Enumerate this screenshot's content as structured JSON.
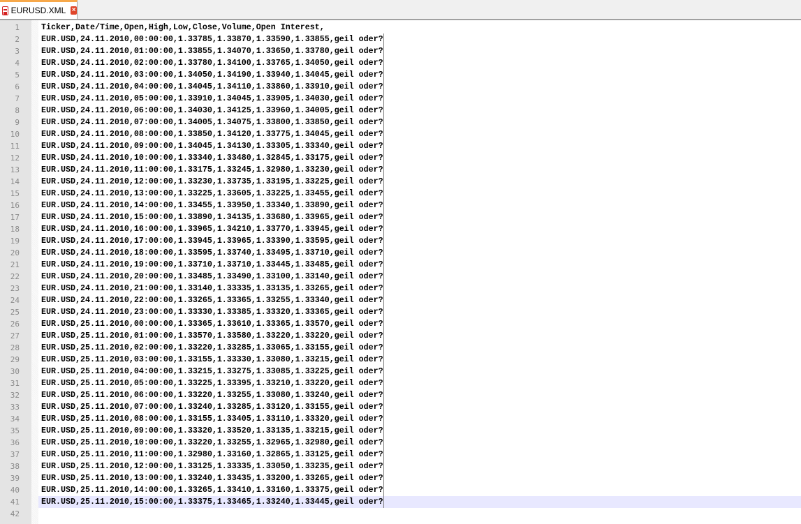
{
  "tab": {
    "title": "EURUSD.XML",
    "icon": "file-icon",
    "close": "×"
  },
  "colors": {
    "current_line": "#e8e8ff",
    "tab_accent": "#f7a84a"
  },
  "editor": {
    "current_line": 41,
    "lines": [
      "Ticker,Date/Time,Open,High,Low,Close,Volume,Open Interest,",
      "EUR.USD,24.11.2010,00:00:00,1.33785,1.33870,1.33590,1.33855,geil oder?",
      "EUR.USD,24.11.2010,01:00:00,1.33855,1.34070,1.33650,1.33780,geil oder?",
      "EUR.USD,24.11.2010,02:00:00,1.33780,1.34100,1.33765,1.34050,geil oder?",
      "EUR.USD,24.11.2010,03:00:00,1.34050,1.34190,1.33940,1.34045,geil oder?",
      "EUR.USD,24.11.2010,04:00:00,1.34045,1.34110,1.33860,1.33910,geil oder?",
      "EUR.USD,24.11.2010,05:00:00,1.33910,1.34045,1.33905,1.34030,geil oder?",
      "EUR.USD,24.11.2010,06:00:00,1.34030,1.34125,1.33960,1.34005,geil oder?",
      "EUR.USD,24.11.2010,07:00:00,1.34005,1.34075,1.33800,1.33850,geil oder?",
      "EUR.USD,24.11.2010,08:00:00,1.33850,1.34120,1.33775,1.34045,geil oder?",
      "EUR.USD,24.11.2010,09:00:00,1.34045,1.34130,1.33305,1.33340,geil oder?",
      "EUR.USD,24.11.2010,10:00:00,1.33340,1.33480,1.32845,1.33175,geil oder?",
      "EUR.USD,24.11.2010,11:00:00,1.33175,1.33245,1.32980,1.33230,geil oder?",
      "EUR.USD,24.11.2010,12:00:00,1.33230,1.33735,1.33195,1.33225,geil oder?",
      "EUR.USD,24.11.2010,13:00:00,1.33225,1.33605,1.33225,1.33455,geil oder?",
      "EUR.USD,24.11.2010,14:00:00,1.33455,1.33950,1.33340,1.33890,geil oder?",
      "EUR.USD,24.11.2010,15:00:00,1.33890,1.34135,1.33680,1.33965,geil oder?",
      "EUR.USD,24.11.2010,16:00:00,1.33965,1.34210,1.33770,1.33945,geil oder?",
      "EUR.USD,24.11.2010,17:00:00,1.33945,1.33965,1.33390,1.33595,geil oder?",
      "EUR.USD,24.11.2010,18:00:00,1.33595,1.33740,1.33495,1.33710,geil oder?",
      "EUR.USD,24.11.2010,19:00:00,1.33710,1.33710,1.33445,1.33485,geil oder?",
      "EUR.USD,24.11.2010,20:00:00,1.33485,1.33490,1.33100,1.33140,geil oder?",
      "EUR.USD,24.11.2010,21:00:00,1.33140,1.33335,1.33135,1.33265,geil oder?",
      "EUR.USD,24.11.2010,22:00:00,1.33265,1.33365,1.33255,1.33340,geil oder?",
      "EUR.USD,24.11.2010,23:00:00,1.33330,1.33385,1.33320,1.33365,geil oder?",
      "EUR.USD,25.11.2010,00:00:00,1.33365,1.33610,1.33365,1.33570,geil oder?",
      "EUR.USD,25.11.2010,01:00:00,1.33570,1.33580,1.33220,1.33220,geil oder?",
      "EUR.USD,25.11.2010,02:00:00,1.33220,1.33285,1.33065,1.33155,geil oder?",
      "EUR.USD,25.11.2010,03:00:00,1.33155,1.33330,1.33080,1.33215,geil oder?",
      "EUR.USD,25.11.2010,04:00:00,1.33215,1.33275,1.33085,1.33225,geil oder?",
      "EUR.USD,25.11.2010,05:00:00,1.33225,1.33395,1.33210,1.33220,geil oder?",
      "EUR.USD,25.11.2010,06:00:00,1.33220,1.33255,1.33080,1.33240,geil oder?",
      "EUR.USD,25.11.2010,07:00:00,1.33240,1.33285,1.33120,1.33155,geil oder?",
      "EUR.USD,25.11.2010,08:00:00,1.33155,1.33405,1.33110,1.33320,geil oder?",
      "EUR.USD,25.11.2010,09:00:00,1.33320,1.33520,1.33135,1.33215,geil oder?",
      "EUR.USD,25.11.2010,10:00:00,1.33220,1.33255,1.32965,1.32980,geil oder?",
      "EUR.USD,25.11.2010,11:00:00,1.32980,1.33160,1.32865,1.33125,geil oder?",
      "EUR.USD,25.11.2010,12:00:00,1.33125,1.33335,1.33050,1.33235,geil oder?",
      "EUR.USD,25.11.2010,13:00:00,1.33240,1.33435,1.33200,1.33265,geil oder?",
      "EUR.USD,25.11.2010,14:00:00,1.33265,1.33410,1.33160,1.33375,geil oder?",
      "EUR.USD,25.11.2010,15:00:00,1.33375,1.33465,1.33240,1.33445,geil oder?",
      ""
    ]
  }
}
